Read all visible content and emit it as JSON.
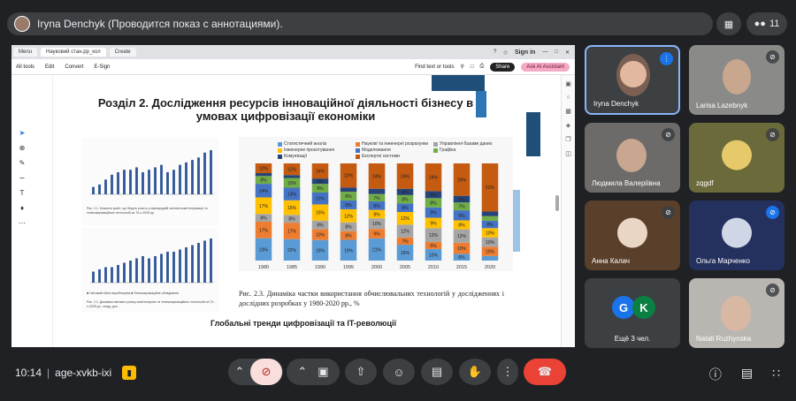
{
  "presenter": {
    "title": "Iryna Denchyk (Проводится показ с аннотациями)."
  },
  "top_right": {
    "people_count": "11"
  },
  "browser": {
    "tabs": [
      "Menu",
      "Науковий стан.рр_кол",
      "Create"
    ],
    "sign_in": "Sign in"
  },
  "acrobat": {
    "menu": [
      "All tools",
      "Edit",
      "Convert",
      "E-Sign"
    ],
    "find": "Find text or tools",
    "share": "Share",
    "ai": "Ask AI Assistant"
  },
  "slide": {
    "title": "Розділ 2. Дослідження ресурсів інноваційної діяльності бізнесу в умовах цифровізації економіки",
    "caption_left_top": "Рис. 2.1. Кількість країн, що беруть участь у міжнародній системі комп'ютеризації та телекомунікаційних технологій за 70-х-2025 рр.",
    "caption_left_bot": "Рис. 2.2. Динаміка світового ринку комп'ютерних та телекомунікаційних технологій за 70-х-2025 рр., млрд. дол.",
    "left_bot_legend": "■ Світовий обсяг виробництва   ■ Телекомунікаційне обладнання",
    "fig_caption": "Рис. 2.3. Динаміка частки використання обчислювальних технологій у дослідженнях і дослідних розробках у 1980-2020 рр., %",
    "subtitle": "Глобальні тренди цифровізації та IT-революції"
  },
  "chart_data": {
    "type": "bar",
    "title": "",
    "categories": [
      "1980",
      "1985",
      "1990",
      "1995",
      "2000",
      "2005",
      "2010",
      "2015",
      "2020"
    ],
    "series": [
      {
        "name": "Статистичний аналіз",
        "color": "#5b9bd5",
        "values": [
          23,
          22,
          19,
          19,
          21,
          15,
          10,
          6,
          5
        ]
      },
      {
        "name": "Наукові та інженерні розрахунки",
        "color": "#ed7d31",
        "values": [
          17,
          17,
          10,
          8,
          9,
          7,
          6,
          10,
          10
        ]
      },
      {
        "name": "Управління базами даних",
        "color": "#a5a5a5",
        "values": [
          8,
          8,
          8,
          8,
          10,
          12,
          12,
          12,
          10
        ]
      },
      {
        "name": "Інженерне проєктування",
        "color": "#ffc000",
        "values": [
          17,
          15,
          15,
          12,
          8,
          12,
          9,
          8,
          10
        ]
      },
      {
        "name": "Моделювання",
        "color": "#4472c4",
        "values": [
          14,
          13,
          11,
          8,
          8,
          8,
          9,
          9,
          8
        ]
      },
      {
        "name": "Графіка",
        "color": "#70ad47",
        "values": [
          8,
          10,
          8,
          8,
          7,
          8,
          8,
          7,
          5
        ]
      },
      {
        "name": "Комунікації",
        "color": "#264478",
        "values": [
          3,
          3,
          5,
          4,
          5,
          6,
          6,
          6,
          5
        ]
      },
      {
        "name": "Експертні системи",
        "color": "#c55a11",
        "values": [
          10,
          12,
          14,
          22,
          24,
          24,
          24,
          29,
          52
        ]
      }
    ],
    "ylim": [
      0,
      100
    ]
  },
  "left_top_chart": {
    "values": [
      3,
      4,
      6,
      8,
      9,
      10,
      10,
      11,
      9,
      10,
      11,
      12,
      9,
      10,
      12,
      13,
      14,
      15,
      17,
      18
    ]
  },
  "left_bot_chart": {
    "values": [
      5,
      6,
      7,
      7,
      8,
      9,
      10,
      11,
      12,
      11,
      12,
      13,
      14,
      14,
      15,
      16,
      17,
      18,
      19,
      20
    ]
  },
  "participants": [
    {
      "name": "Iryna Denchyk"
    },
    {
      "name": "Larisa Lazebnyk"
    },
    {
      "name": "Людмила Валеріївна"
    },
    {
      "name": "zqgdf"
    },
    {
      "name": "Анна Калач"
    },
    {
      "name": "Ольга Марченко"
    },
    {
      "name": "Ещё 3 чел.",
      "letters": [
        "G",
        "K"
      ]
    },
    {
      "name": "Natali Ruzhynska"
    }
  ],
  "bottom": {
    "time": "10:14",
    "meeting_code": "age-xvkb-ixi"
  }
}
